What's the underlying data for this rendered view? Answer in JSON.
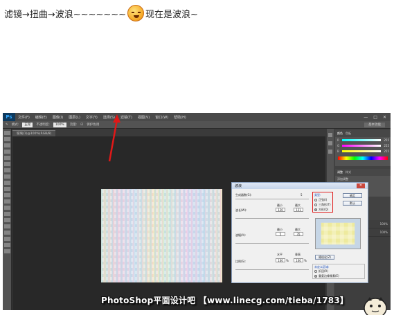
{
  "caption": {
    "prefix": "滤镜→扭曲→波浪~~~~~~~",
    "suffix": "现在是波浪~"
  },
  "app": {
    "logo": "Ps",
    "menu": [
      "文件(F)",
      "编辑(E)",
      "图像(I)",
      "图层(L)",
      "文字(Y)",
      "选择(S)",
      "滤镜(T)",
      "视图(V)",
      "窗口(W)",
      "帮助(H)"
    ],
    "window_controls": [
      "—",
      "□",
      "✕"
    ],
    "options": {
      "mode_label": "模式:",
      "mode_value": "正常",
      "opacity_label": "不透明度:",
      "opacity_value": "100%",
      "flow_label": "流量:",
      "protect_label": "保护色调",
      "workspace": "基本功能"
    },
    "document_tab": "玻璃(1)@100%(RGB/8)",
    "color_panel": {
      "tabs": [
        "颜色",
        "色板"
      ],
      "channels": [
        {
          "label": "R",
          "value": "255",
          "color": "#ff4a4a"
        },
        {
          "label": "G",
          "value": "255",
          "color": "#4aff4a"
        },
        {
          "label": "B",
          "value": "255",
          "color": "#4a7aff"
        }
      ]
    },
    "adjust_panel": {
      "tabs": [
        "调整",
        "样式"
      ],
      "subtitle": "添加调整"
    },
    "layers_panel": {
      "opacity": "100%",
      "fill": "100%"
    }
  },
  "dialog": {
    "title": "波浪",
    "close": "✕",
    "generators_label": "生成器数(G):",
    "generators_value": "5",
    "wavelength_label": "波长(W):",
    "wavelength_min_label": "最小",
    "wavelength_max_label": "最大",
    "wavelength_min": "120",
    "wavelength_max": "121",
    "amplitude_label": "波幅(A):",
    "amplitude_min_label": "最小",
    "amplitude_max_label": "最大",
    "amplitude_min": "5",
    "amplitude_max": "35",
    "scale_label": "比例(S):",
    "scale_h_label": "水平",
    "scale_v_label": "垂直",
    "scale_h": "100",
    "scale_v": "100",
    "scale_unit": "%",
    "type_label": "类型:",
    "type_options": [
      {
        "label": "正弦(I)",
        "selected": false
      },
      {
        "label": "三角形(T)",
        "selected": false
      },
      {
        "label": "方形(Q)",
        "selected": true
      }
    ],
    "ok_label": "确定",
    "default_label": "默认",
    "randomize_label": "随机化(Z)",
    "undefined_label": "未定义区域:",
    "undefined_options": [
      {
        "label": "折回(R)",
        "selected": false
      },
      {
        "label": "重复边缘像素(E)",
        "selected": true
      }
    ]
  },
  "watermark": {
    "text": "PhotoShop平面设计吧 【www.linecg.com/tieba/1783】"
  }
}
